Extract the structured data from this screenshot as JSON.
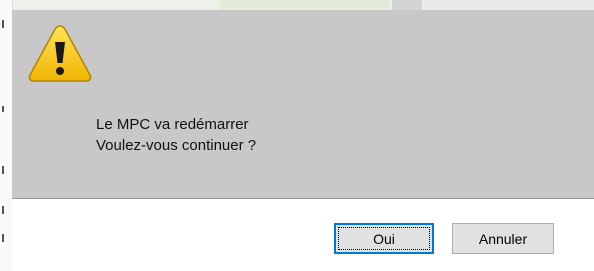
{
  "dialog": {
    "icon": "warning-icon",
    "message_line1": "Le MPC va redémarrer",
    "message_line2": "Voulez-vous continuer ?",
    "buttons": {
      "yes_label": "Oui",
      "cancel_label": "Annuler"
    }
  },
  "colors": {
    "message_background": "#c8c8c8",
    "button_bar_background": "#ffffff",
    "warning_yellow": "#f5c400",
    "default_button_border": "#0078d7"
  }
}
